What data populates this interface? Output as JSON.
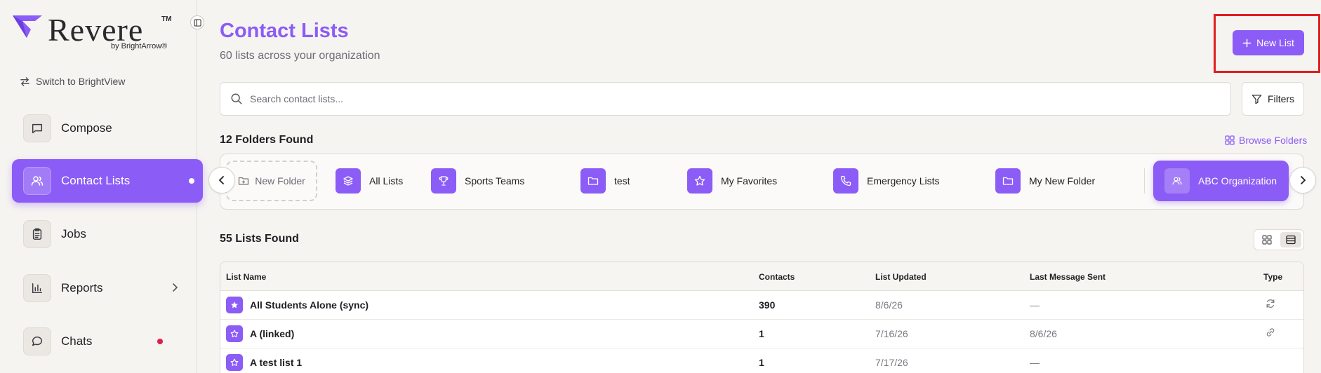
{
  "brand": {
    "name": "Revere",
    "trademark": "TM",
    "byline": "by BrightArrow®",
    "accent": "#8b5cf6"
  },
  "sidebar": {
    "switch_label": "Switch to BrightView",
    "items": [
      {
        "label": "Compose",
        "icon": "message-square-icon",
        "active": false
      },
      {
        "label": "Contact Lists",
        "icon": "users-icon",
        "active": true
      },
      {
        "label": "Jobs",
        "icon": "clipboard-icon",
        "active": false
      },
      {
        "label": "Reports",
        "icon": "bar-chart-icon",
        "active": false
      },
      {
        "label": "Chats",
        "icon": "chat-bubble-icon",
        "active": false
      }
    ]
  },
  "header": {
    "title": "Contact Lists",
    "subtitle": "60 lists across your organization",
    "new_list_label": "New List"
  },
  "search": {
    "placeholder": "Search contact lists...",
    "value": ""
  },
  "filters_label": "Filters",
  "folders": {
    "heading": "12 Folders Found",
    "browse_label": "Browse Folders",
    "new_folder_label": "New Folder",
    "items": [
      {
        "label": "All Lists",
        "icon": "layers-icon"
      },
      {
        "label": "Sports Teams",
        "icon": "trophy-icon"
      },
      {
        "label": "test",
        "icon": "folder-icon"
      },
      {
        "label": "My Favorites",
        "icon": "star-icon"
      },
      {
        "label": "Emergency Lists",
        "icon": "phone-icon"
      },
      {
        "label": "My New Folder",
        "icon": "folder-icon"
      },
      {
        "label": "ABC Organization",
        "icon": "users-icon",
        "active": true
      }
    ]
  },
  "lists": {
    "heading": "55 Lists Found",
    "columns": [
      "List Name",
      "Contacts",
      "List Updated",
      "Last Message Sent",
      "Type"
    ],
    "rows": [
      {
        "name": "All Students Alone (sync)",
        "contacts": "390",
        "updated": "8/6/26",
        "last_sent": "—",
        "type_icon": "sync-icon",
        "starred": true
      },
      {
        "name": "A (linked)",
        "contacts": "1",
        "updated": "7/16/26",
        "last_sent": "8/6/26",
        "type_icon": "link-icon",
        "starred": false
      },
      {
        "name": "A test list 1",
        "contacts": "1",
        "updated": "7/17/26",
        "last_sent": "—",
        "type_icon": "",
        "starred": false
      }
    ]
  }
}
